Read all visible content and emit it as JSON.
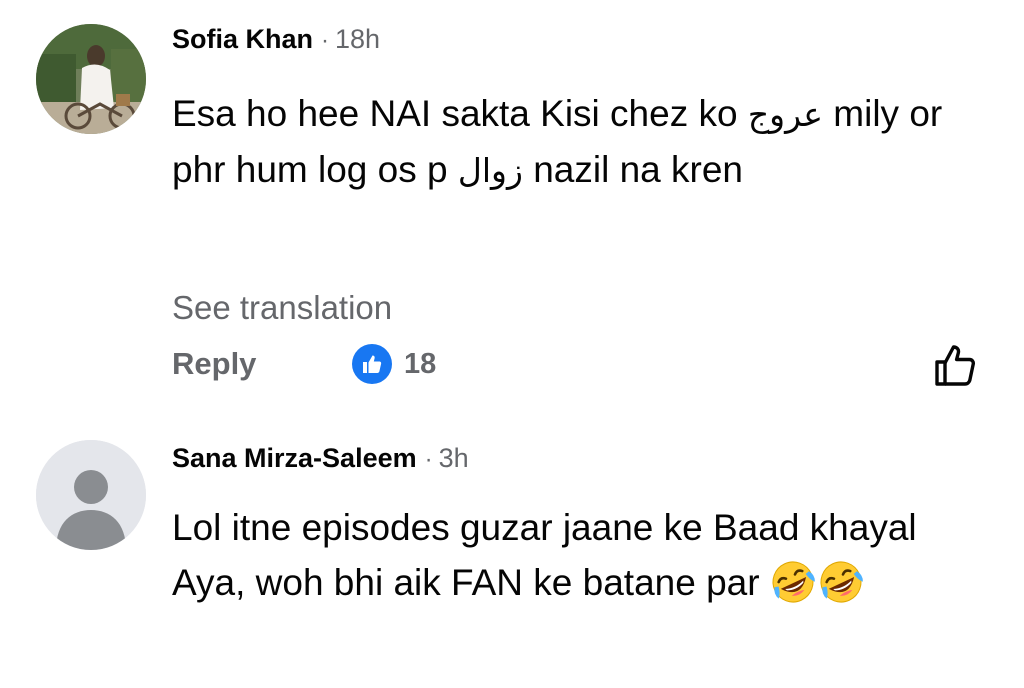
{
  "comments": [
    {
      "author": "Sofia Khan",
      "time": "18h",
      "text_part1": "Esa ho hee NAI sakta Kisi chez ko ",
      "text_urdu1": "عروج",
      "text_part2": " mily or phr hum log os p ",
      "text_urdu2": "زوال",
      "text_part3": " nazil na kren",
      "see_translation": "See translation",
      "reply_label": "Reply",
      "reaction_icon": "like-icon",
      "reaction_count": "18",
      "like_button_icon": "thumbs-up-outline-icon"
    },
    {
      "author": "Sana Mirza-Saleem",
      "time": "3h",
      "text": "Lol itne episodes guzar jaane ke Baad khayal Aya, woh bhi aik FAN ke batane par ",
      "emojis": [
        "rolling-on-floor-laughing-emoji",
        "rolling-on-floor-laughing-emoji"
      ]
    }
  ],
  "separator": "·",
  "colors": {
    "primary_text": "#050505",
    "secondary_text": "#65676b",
    "like_blue": "#1877f2",
    "default_avatar_bg": "#e4e6eb",
    "default_avatar_fg": "#8a8d91"
  }
}
